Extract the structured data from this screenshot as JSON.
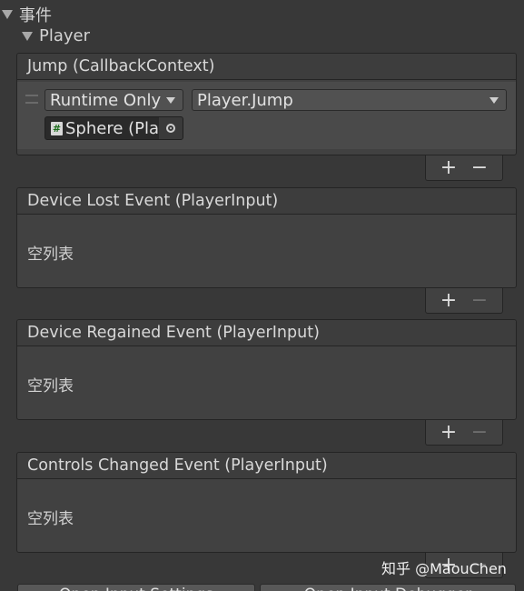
{
  "events_foldout": {
    "label": "事件"
  },
  "player_foldout": {
    "label": "Player"
  },
  "jump_event": {
    "title": "Jump (CallbackContext)",
    "listener": {
      "runtime_mode": "Runtime Only",
      "function": "Player.Jump",
      "target_object": "Sphere (Player)"
    }
  },
  "device_lost_event": {
    "title": "Device Lost Event (PlayerInput)",
    "empty_label": "空列表"
  },
  "device_regained_event": {
    "title": "Device Regained Event (PlayerInput)",
    "empty_label": "空列表"
  },
  "controls_changed_event": {
    "title": "Controls Changed Event (PlayerInput)",
    "empty_label": "空列表"
  },
  "list_buttons": {
    "add": "+",
    "remove": "−"
  },
  "bottom_buttons": {
    "open_input_settings": "Open Input Settings",
    "open_input_debugger": "Open Input Debugger"
  },
  "watermark": "知乎 @MaouChen"
}
